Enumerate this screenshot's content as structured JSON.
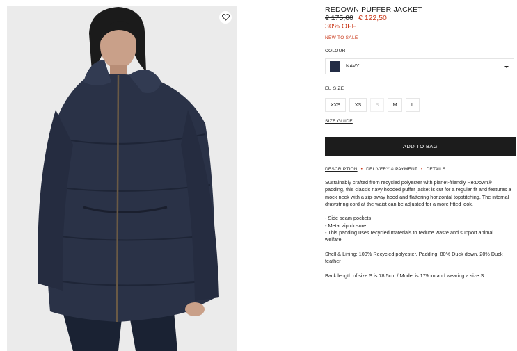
{
  "product": {
    "title": "REDOWN PUFFER JACKET",
    "old_price": "€ 175,00",
    "new_price": "€ 122,50",
    "discount": "30% OFF",
    "badge": "NEW TO SALE"
  },
  "image": {
    "alt": "Model wearing navy puffer jacket"
  },
  "colour": {
    "label": "COLOUR",
    "selected": "NAVY",
    "swatch_color": "#232c45"
  },
  "size": {
    "label": "EU SIZE",
    "options": [
      "XXS",
      "XS",
      "S",
      "M",
      "L"
    ],
    "guide": "SIZE GUIDE"
  },
  "actions": {
    "add_to_bag": "ADD TO BAG"
  },
  "tabs": [
    "DESCRIPTION",
    "DELIVERY & PAYMENT",
    "DETAILS"
  ],
  "description": {
    "intro": "Sustainably crafted from recycled polyester with planet-friendly Re:Down® padding, this classic navy hooded puffer jacket is cut for a regular fit and features a mock neck with a zip-away hood and flattering horizontal topstitching. The internal drawstring cord at the waist can be adjusted for a more fitted look.",
    "bullets": [
      "- Side seam pockets",
      "- Metal zip closure",
      "- This padding uses recycled materials to reduce waste and support animal welfare."
    ],
    "materials": "Shell & Lining: 100% Recycled polyester, Padding: 80% Duck down, 20% Duck feather",
    "fit": "Back length of size S is 78.5cm / Model is 179cm and wearing a size S"
  },
  "colors": {
    "sale": "#c9381a",
    "button_bg": "#1c1c1c"
  }
}
